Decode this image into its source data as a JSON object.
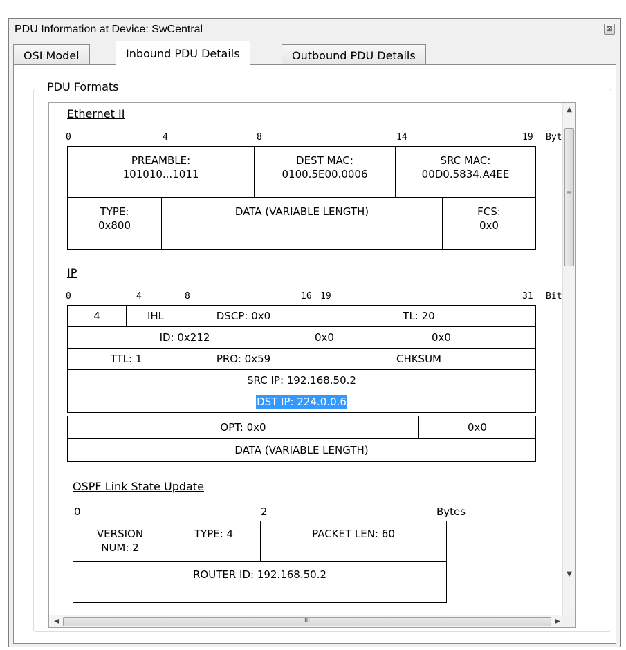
{
  "window": {
    "title": "PDU Information at Device: SwCentral",
    "close_glyph": "⊠"
  },
  "tabs": [
    {
      "label": "OSI Model"
    },
    {
      "label": "Inbound PDU Details"
    },
    {
      "label": "Outbound PDU Details"
    }
  ],
  "group": {
    "legend": "PDU Formats"
  },
  "ethernet": {
    "title": "Ethernet II",
    "ruler": [
      "0",
      "4",
      "8",
      "14",
      "19",
      "Byt"
    ],
    "preamble": [
      "PREAMBLE:",
      "101010...1011"
    ],
    "dest_mac": [
      "DEST MAC:",
      "0100.5E00.0006"
    ],
    "src_mac": [
      "SRC MAC:",
      "00D0.5834.A4EE"
    ],
    "type": [
      "TYPE:",
      "0x800"
    ],
    "data": "DATA (VARIABLE LENGTH)",
    "fcs": [
      "FCS:",
      "0x0"
    ]
  },
  "ip": {
    "title": "IP",
    "ruler": [
      "0",
      "4",
      "8",
      "16",
      "19",
      "31",
      "Bits"
    ],
    "version": "4",
    "ihl": "IHL",
    "dscp": "DSCP: 0x0",
    "tl": "TL: 20",
    "id": "ID: 0x212",
    "flags": "0x0",
    "frag": "0x0",
    "ttl": "TTL: 1",
    "pro": "PRO: 0x59",
    "chksum": "CHKSUM",
    "src_ip": "SRC IP: 192.168.50.2",
    "dst_ip": "DST IP: 224.0.0.6",
    "opt": "OPT: 0x0",
    "opt_pad": "0x0",
    "data": "DATA (VARIABLE LENGTH)"
  },
  "ospf": {
    "title": "OSPF Link State Update",
    "ruler": [
      "0",
      "2",
      "Bytes"
    ],
    "version": [
      "VERSION",
      "NUM: 2"
    ],
    "type": "TYPE: 4",
    "packet_len": "PACKET LEN: 60",
    "router_id": "ROUTER ID: 192.168.50.2"
  },
  "scrollbars": {
    "up": "▲",
    "down": "▼",
    "left": "◀",
    "right": "▶",
    "grip_v": "≡",
    "grip_h": "III"
  }
}
